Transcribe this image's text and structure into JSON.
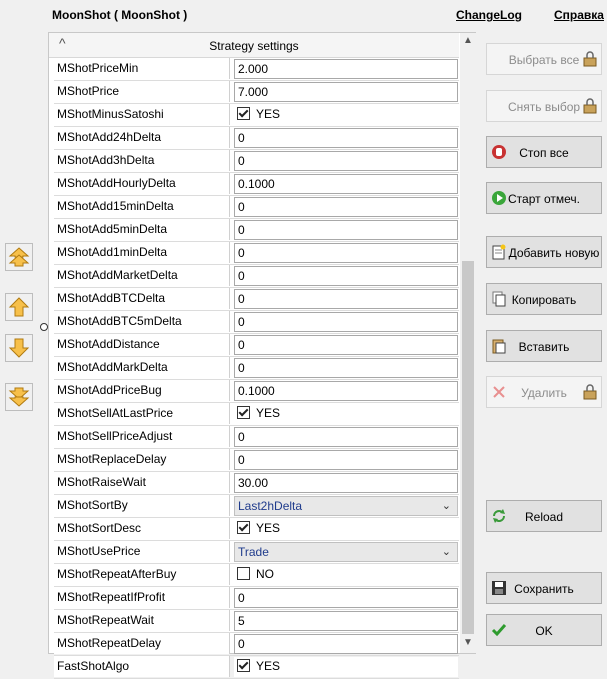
{
  "app": {
    "title": "MoonShot  ( MoonShot )"
  },
  "links": {
    "changelog": "ChangeLog",
    "help": "Справка"
  },
  "settings": {
    "header": "Strategy settings",
    "rows": [
      {
        "name": "MShotPriceMin",
        "type": "text",
        "value": "2.000"
      },
      {
        "name": "MShotPrice",
        "type": "text",
        "value": "7.000"
      },
      {
        "name": "MShotMinusSatoshi",
        "type": "check",
        "checked": true,
        "value": "YES"
      },
      {
        "name": "MShotAdd24hDelta",
        "type": "text",
        "value": "0"
      },
      {
        "name": "MShotAdd3hDelta",
        "type": "text",
        "value": "0"
      },
      {
        "name": "MShotAddHourlyDelta",
        "type": "text",
        "value": "0.1000"
      },
      {
        "name": "MShotAdd15minDelta",
        "type": "text",
        "value": "0"
      },
      {
        "name": "MShotAdd5minDelta",
        "type": "text",
        "value": "0"
      },
      {
        "name": "MShotAdd1minDelta",
        "type": "text",
        "value": "0"
      },
      {
        "name": "MShotAddMarketDelta",
        "type": "text",
        "value": "0"
      },
      {
        "name": "MShotAddBTCDelta",
        "type": "text",
        "value": "0"
      },
      {
        "name": "MShotAddBTC5mDelta",
        "type": "text",
        "value": "0"
      },
      {
        "name": "MShotAddDistance",
        "type": "text",
        "value": "0"
      },
      {
        "name": "MShotAddMarkDelta",
        "type": "text",
        "value": "0"
      },
      {
        "name": "MShotAddPriceBug",
        "type": "text",
        "value": "0.1000"
      },
      {
        "name": "MShotSellAtLastPrice",
        "type": "check",
        "checked": true,
        "value": "YES"
      },
      {
        "name": "MShotSellPriceAdjust",
        "type": "text",
        "value": "0"
      },
      {
        "name": "MShotReplaceDelay",
        "type": "text",
        "value": "0"
      },
      {
        "name": "MShotRaiseWait",
        "type": "text",
        "value": "30.00"
      },
      {
        "name": "MShotSortBy",
        "type": "select",
        "value": "Last2hDelta"
      },
      {
        "name": "MShotSortDesc",
        "type": "check",
        "checked": true,
        "value": "YES"
      },
      {
        "name": "MShotUsePrice",
        "type": "select",
        "value": "Trade"
      },
      {
        "name": "MShotRepeatAfterBuy",
        "type": "check",
        "checked": false,
        "value": "NO"
      },
      {
        "name": "MShotRepeatIfProfit",
        "type": "text",
        "value": "0"
      },
      {
        "name": "MShotRepeatWait",
        "type": "text",
        "value": "5"
      },
      {
        "name": "MShotRepeatDelay",
        "type": "text",
        "value": "0"
      },
      {
        "name": "FastShotAlgo",
        "type": "check",
        "checked": true,
        "value": "YES"
      }
    ]
  },
  "buttons": {
    "select_all": "Выбрать все",
    "deselect": "Снять выбор",
    "stop_all": "Стоп все",
    "start_marked": "Старт отмеч.",
    "add_new": "Добавить новую",
    "copy": "Копировать",
    "paste": "Вставить",
    "delete": "Удалить",
    "reload": "Reload",
    "save": "Сохранить",
    "ok": "OK"
  },
  "icons": {
    "move_top": "double-up-arrow-icon",
    "move_up": "up-arrow-icon",
    "move_down": "down-arrow-icon",
    "move_bottom": "double-down-arrow-icon"
  },
  "colors": {
    "arrow_fill": "#f7c04a",
    "select_text": "#1f3b8c",
    "ok_check": "#2e9b2e",
    "stop_red": "#c83232"
  }
}
